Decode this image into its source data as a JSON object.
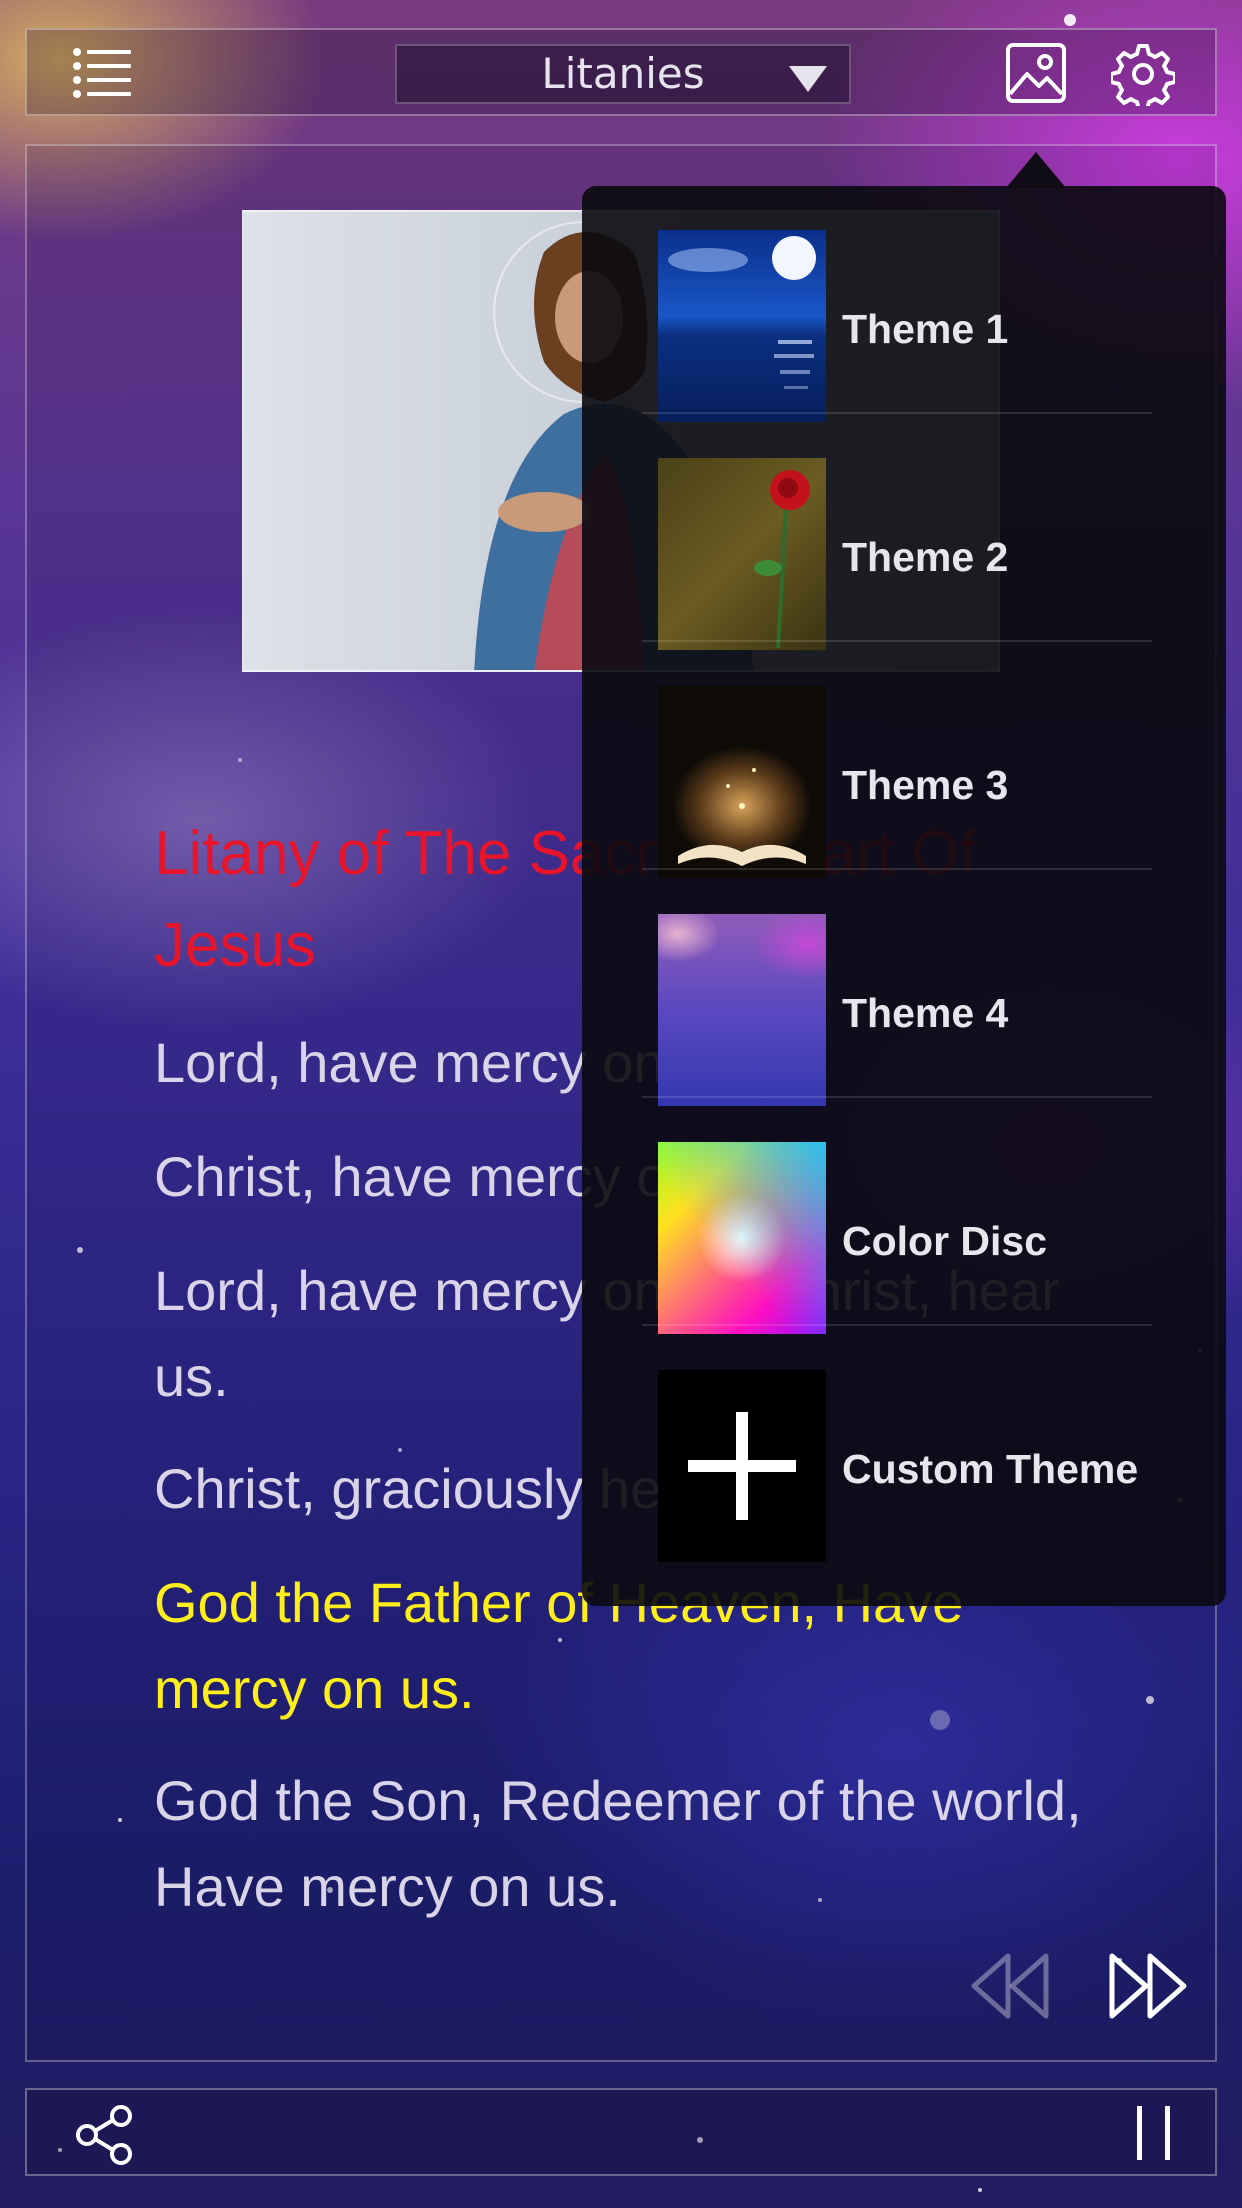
{
  "header": {
    "dropdown_value": "Litanies"
  },
  "content": {
    "title": "Litany of The Sacred Heart Of Jesus",
    "verses": [
      "Lord, have mercy on us.",
      "Christ, have mercy on us.",
      "Lord, have mercy on us. Christ, hear us.",
      "Christ, graciously hear us.",
      "God the Father of Heaven, Have mercy on us.",
      "God the Son, Redeemer of the world, Have mercy on us."
    ],
    "highlight_color": "#ffee1a",
    "title_color": "#e8142a"
  },
  "theme_menu": {
    "items": [
      {
        "label": "Theme 1",
        "thumb": "night-sea-moon"
      },
      {
        "label": "Theme 2",
        "thumb": "rose-on-old-paper"
      },
      {
        "label": "Theme 3",
        "thumb": "glowing-open-book"
      },
      {
        "label": "Theme 4",
        "thumb": "purple-galaxy"
      },
      {
        "label": "Color Disc",
        "thumb": "color-cube"
      },
      {
        "label": "Custom Theme",
        "thumb": "plus-icon"
      }
    ]
  },
  "icons": {
    "menu": "list-icon",
    "theme": "image-icon",
    "settings": "gear-icon",
    "prev": "rewind-icon",
    "next": "fast-forward-icon",
    "share": "share-icon",
    "pause": "pause-icon"
  }
}
